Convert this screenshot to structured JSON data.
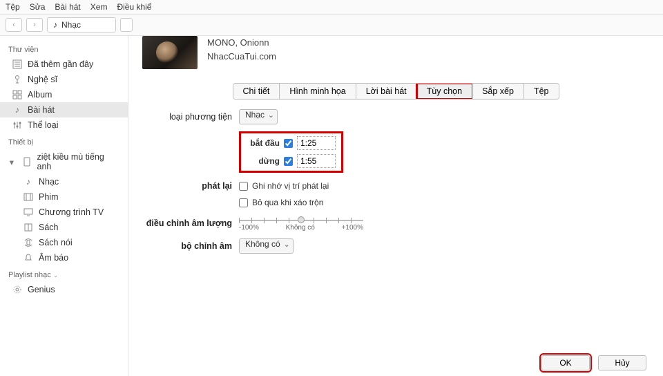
{
  "menu": {
    "items": [
      "Tệp",
      "Sửa",
      "Bài hát",
      "Xem",
      "Điều khiể"
    ]
  },
  "toolbar": {
    "library_label": "Nhạc"
  },
  "sidebar": {
    "sections": [
      {
        "heading": "Thư viện",
        "items": [
          {
            "icon": "clock",
            "label": "Đã thêm gần đây"
          },
          {
            "icon": "mic",
            "label": "Nghệ sĩ"
          },
          {
            "icon": "grid",
            "label": "Album"
          },
          {
            "icon": "note",
            "label": "Bài hát",
            "active": true
          },
          {
            "icon": "sliders",
            "label": "Thể loại"
          }
        ]
      },
      {
        "heading": "Thiết bị",
        "items": [
          {
            "icon": "phone",
            "label": "ziệt kiều mù tiếng anh",
            "expand": true
          },
          {
            "icon": "note",
            "label": "Nhạc",
            "indent": true
          },
          {
            "icon": "film",
            "label": "Phim",
            "indent": true
          },
          {
            "icon": "tv",
            "label": "Chương trình TV",
            "indent": true
          },
          {
            "icon": "book",
            "label": "Sách",
            "indent": true
          },
          {
            "icon": "audiobook",
            "label": "Sách nói",
            "indent": true
          },
          {
            "icon": "bell",
            "label": "Âm báo",
            "indent": true
          }
        ]
      },
      {
        "heading": "Playlist nhạc",
        "items": [
          {
            "icon": "genius",
            "label": "Genius"
          }
        ]
      }
    ]
  },
  "dialog": {
    "artist": "MONO, Onionn",
    "source": "NhacCuaTui.com",
    "tabs": [
      "Chi tiết",
      "Hình minh họa",
      "Lời bài hát",
      "Tùy chọn",
      "Sắp xếp",
      "Tệp"
    ],
    "active_tab": "Tùy chọn",
    "labels": {
      "media_type": "loại phương tiện",
      "start": "bắt đầu",
      "stop": "dừng",
      "playback": "phát lại",
      "remember_pos": "Ghi nhớ vị trí phát lại",
      "skip_shuffle": "Bỏ qua khi xáo trộn",
      "volume_adj": "điều chỉnh âm lượng",
      "eq": "bộ chỉnh âm"
    },
    "values": {
      "media_type": "Nhạc",
      "start": "1:25",
      "stop": "1:55",
      "start_checked": true,
      "stop_checked": true,
      "remember_checked": false,
      "skip_checked": false,
      "eq": "Không có",
      "vol_minus": "-100%",
      "vol_none": "Không có",
      "vol_plus": "+100%"
    },
    "buttons": {
      "ok": "OK",
      "cancel": "Hủy"
    }
  }
}
